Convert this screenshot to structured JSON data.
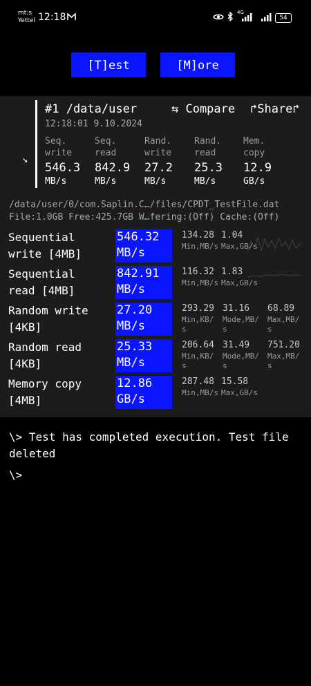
{
  "status_bar": {
    "carrier_line1": "mt:s",
    "carrier_line2": "Yettel",
    "time": "12:18",
    "battery": "54"
  },
  "toolbar": {
    "test_label": "[T]est",
    "more_label": "[M]ore"
  },
  "result": {
    "title": "#1 /data/user",
    "compare_label": "⇆ Compare",
    "share_label": "↱Share↱",
    "timestamp": "12:18:01 9.10.2024",
    "summary": [
      {
        "label1": "Seq.",
        "label2": "write",
        "value": "546.3",
        "unit": "MB/s"
      },
      {
        "label1": "Seq.",
        "label2": "read",
        "value": "842.9",
        "unit": "MB/s"
      },
      {
        "label1": "Rand.",
        "label2": "write",
        "value": "27.2",
        "unit": "MB/s"
      },
      {
        "label1": "Rand.",
        "label2": "read",
        "value": "25.3",
        "unit": "MB/s"
      },
      {
        "label1": "Mem.",
        "label2": "copy",
        "value": "12.9",
        "unit": "GB/s"
      }
    ]
  },
  "file_info": {
    "path": "/data/user/0/com.Saplin.C…/files/CPDT_TestFile.dat",
    "details": "File:1.0GB Free:425.7GB W…fering:(Off) Cache:(Off)"
  },
  "tests": [
    {
      "label": "Sequential\nwrite [4MB]",
      "value": "546.32",
      "unit": "MB/s",
      "stats": [
        {
          "v": "134.28",
          "u": "Min,MB/s"
        },
        {
          "v": "1.04",
          "u": "Max,GB/s"
        }
      ]
    },
    {
      "label": "Sequential\nread [4MB]",
      "value": "842.91",
      "unit": "MB/s",
      "stats": [
        {
          "v": "116.32",
          "u": "Min,MB/s"
        },
        {
          "v": "1.83",
          "u": "Max,GB/s"
        }
      ]
    },
    {
      "label": "Random write\n[4KB]",
      "value": "27.20",
      "unit": "MB/s",
      "stats": [
        {
          "v": "293.29",
          "u": "Min,KB/\ns"
        },
        {
          "v": "31.16",
          "u": "Mode,MB/\ns"
        },
        {
          "v": "68.89",
          "u": "Max,MB/\ns"
        }
      ]
    },
    {
      "label": "Random read\n[4KB]",
      "value": "25.33",
      "unit": "MB/s",
      "stats": [
        {
          "v": "206.64",
          "u": "Min,KB/\ns"
        },
        {
          "v": "31.49",
          "u": "Mode,MB/\ns"
        },
        {
          "v": "751.20",
          "u": "Max,MB/\ns"
        }
      ]
    },
    {
      "label": "Memory copy\n[4MB]",
      "value": "12.86",
      "unit": "GB/s",
      "stats": [
        {
          "v": "287.48",
          "u": "Min,MB/s"
        },
        {
          "v": "15.58",
          "u": "Max,GB/s"
        }
      ]
    }
  ],
  "console": {
    "message": "\\> Test has completed execution. Test file deleted",
    "prompt": "\\>"
  }
}
